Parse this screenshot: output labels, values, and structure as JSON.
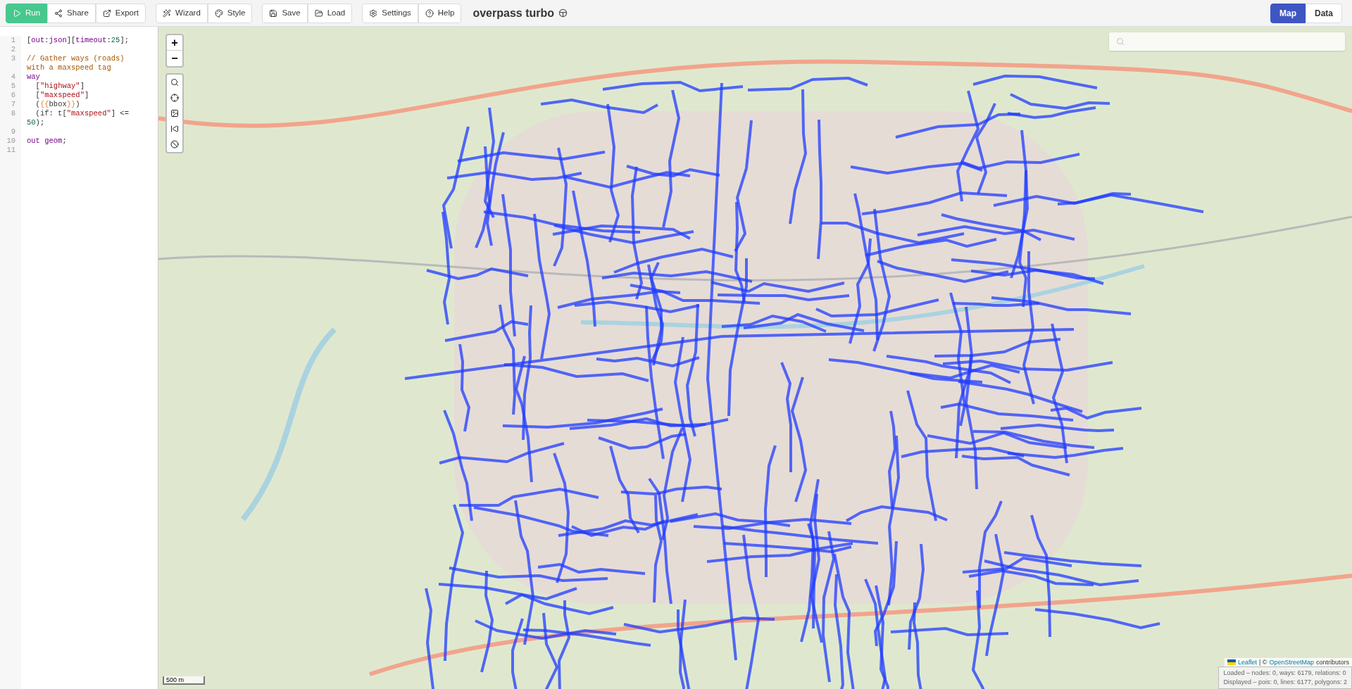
{
  "toolbar": {
    "groups": [
      [
        {
          "label": "Run"
        },
        {
          "label": "Share"
        },
        {
          "label": "Export"
        }
      ],
      [
        {
          "label": "Wizard"
        },
        {
          "label": "Style"
        }
      ],
      [
        {
          "label": "Save"
        },
        {
          "label": "Load"
        }
      ],
      [
        {
          "label": "Settings"
        },
        {
          "label": "Help"
        }
      ]
    ],
    "title": "overpass turbo"
  },
  "view_tabs": [
    {
      "label": "Map",
      "selected": true
    },
    {
      "label": "Data",
      "selected": false
    }
  ],
  "editor": {
    "lines": [
      {
        "number": "1",
        "tokens": [
          {
            "kind": "plain",
            "text": "["
          },
          {
            "kind": "keyword",
            "text": "out"
          },
          {
            "kind": "plain",
            "text": ":"
          },
          {
            "kind": "keyword",
            "text": "json"
          },
          {
            "kind": "plain",
            "text": "]["
          },
          {
            "kind": "keyword",
            "text": "timeout"
          },
          {
            "kind": "plain",
            "text": ":"
          },
          {
            "kind": "number",
            "text": "25"
          },
          {
            "kind": "plain",
            "text": "];"
          }
        ]
      },
      {
        "number": "2"
      },
      {
        "number": "3",
        "tokens": [
          {
            "kind": "comment",
            "text": "// Gather ways (roads) with a maxspeed tag"
          }
        ]
      },
      {
        "number": "4",
        "tokens": [
          {
            "kind": "keyword",
            "text": "way"
          }
        ]
      },
      {
        "number": "5",
        "tokens": [
          {
            "kind": "plain",
            "text": "  ["
          },
          {
            "kind": "string",
            "text": "\"highway\""
          },
          {
            "kind": "plain",
            "text": "]"
          }
        ]
      },
      {
        "number": "6",
        "tokens": [
          {
            "kind": "plain",
            "text": "  ["
          },
          {
            "kind": "string",
            "text": "\"maxspeed\""
          },
          {
            "kind": "plain",
            "text": "]"
          }
        ]
      },
      {
        "number": "7",
        "tokens": [
          {
            "kind": "plain",
            "text": "  ("
          },
          {
            "kind": "brace",
            "text": "{{"
          },
          {
            "kind": "plain",
            "text": "bbox"
          },
          {
            "kind": "brace",
            "text": "}}"
          },
          {
            "kind": "plain",
            "text": ")"
          }
        ]
      },
      {
        "number": "8",
        "tokens": [
          {
            "kind": "plain",
            "text": "  (if: t["
          },
          {
            "kind": "string",
            "text": "\"maxspeed\""
          },
          {
            "kind": "plain",
            "text": "] <= "
          },
          {
            "kind": "number",
            "text": "50"
          },
          {
            "kind": "plain",
            "text": ");"
          }
        ]
      },
      {
        "number": "9"
      },
      {
        "number": "10",
        "tokens": [
          {
            "kind": "keyword",
            "text": "out geom"
          },
          {
            "kind": "plain",
            "text": ";"
          }
        ]
      },
      {
        "number": "11"
      }
    ]
  },
  "map": {
    "zoom_controls": [
      "+",
      "−"
    ],
    "scale": "500 m",
    "attribution": {
      "leaflet": "Leaflet",
      "separator": "| ©",
      "osm": "OpenStreetMap",
      "suffix": "contributors"
    },
    "status": [
      "Loaded – nodes: 0, ways: 6179, relations: 0",
      "Displayed – pois: 0, lines: 6177, polygons: 2"
    ]
  }
}
